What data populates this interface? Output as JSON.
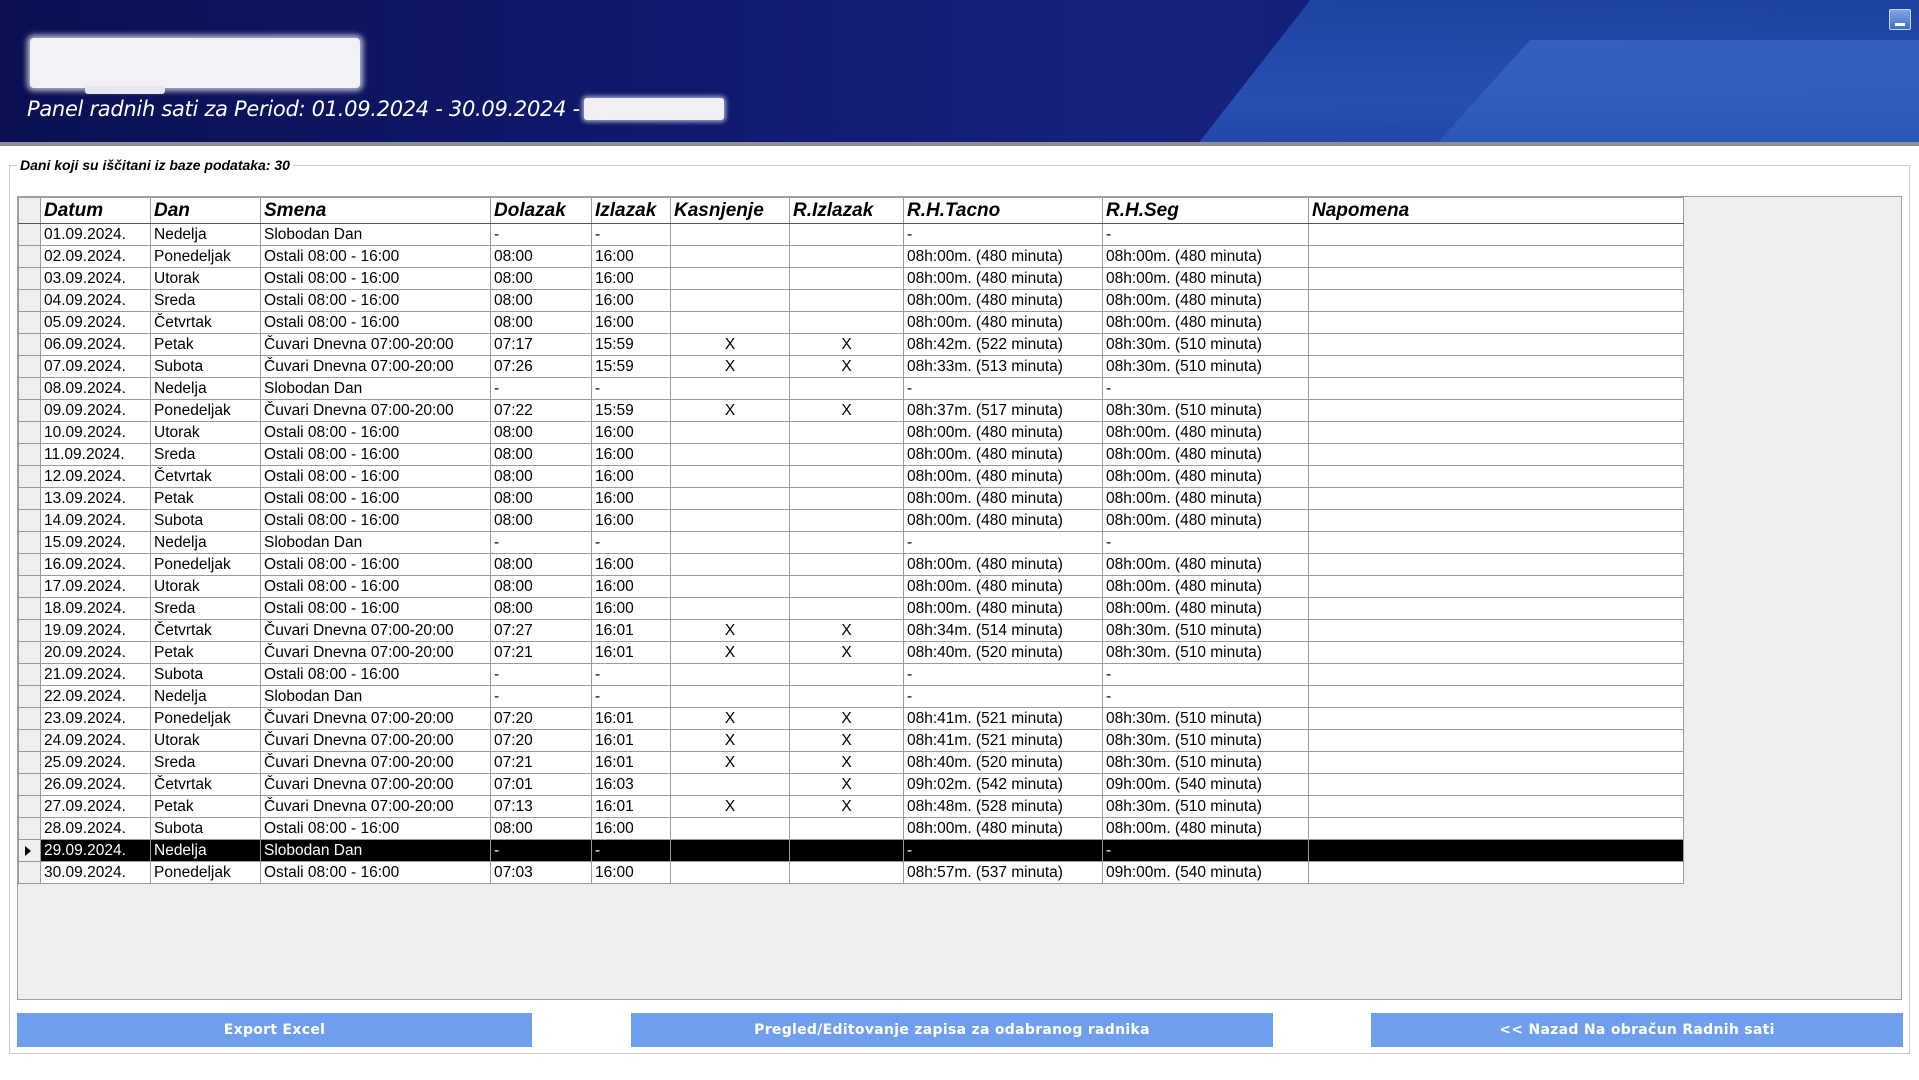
{
  "header": {
    "panel_title": "Panel radnih sati za Period: 01.09.2024 - 30.09.2024 -"
  },
  "groupbox": {
    "title": "Dani koji su iščitani iz baze podataka: 30"
  },
  "grid": {
    "columns": [
      "Datum",
      "Dan",
      "Smena",
      "Dolazak",
      "Izlazak",
      "Kasnjenje",
      "R.Izlazak",
      "R.H.Tacno",
      "R.H.Seg",
      "Napomena"
    ],
    "selected_row_index": 28,
    "rows": [
      [
        "01.09.2024.",
        "Nedelja",
        "Slobodan Dan",
        "-",
        "-",
        "",
        "",
        "-",
        "-",
        ""
      ],
      [
        "02.09.2024.",
        "Ponedeljak",
        "Ostali 08:00 - 16:00",
        "08:00",
        "16:00",
        "",
        "",
        "08h:00m. (480 minuta)",
        "08h:00m. (480 minuta)",
        ""
      ],
      [
        "03.09.2024.",
        "Utorak",
        "Ostali 08:00 - 16:00",
        "08:00",
        "16:00",
        "",
        "",
        "08h:00m. (480 minuta)",
        "08h:00m. (480 minuta)",
        ""
      ],
      [
        "04.09.2024.",
        "Sreda",
        "Ostali 08:00 - 16:00",
        "08:00",
        "16:00",
        "",
        "",
        "08h:00m. (480 minuta)",
        "08h:00m. (480 minuta)",
        ""
      ],
      [
        "05.09.2024.",
        "Četvrtak",
        "Ostali 08:00 - 16:00",
        "08:00",
        "16:00",
        "",
        "",
        "08h:00m. (480 minuta)",
        "08h:00m. (480 minuta)",
        ""
      ],
      [
        "06.09.2024.",
        "Petak",
        "Čuvari Dnevna 07:00-20:00",
        "07:17",
        "15:59",
        "X",
        "X",
        "08h:42m. (522 minuta)",
        "08h:30m. (510 minuta)",
        ""
      ],
      [
        "07.09.2024.",
        "Subota",
        "Čuvari Dnevna 07:00-20:00",
        "07:26",
        "15:59",
        "X",
        "X",
        "08h:33m. (513 minuta)",
        "08h:30m. (510 minuta)",
        ""
      ],
      [
        "08.09.2024.",
        "Nedelja",
        "Slobodan Dan",
        "-",
        "-",
        "",
        "",
        "-",
        "-",
        ""
      ],
      [
        "09.09.2024.",
        "Ponedeljak",
        "Čuvari Dnevna 07:00-20:00",
        "07:22",
        "15:59",
        "X",
        "X",
        "08h:37m. (517 minuta)",
        "08h:30m. (510 minuta)",
        ""
      ],
      [
        "10.09.2024.",
        "Utorak",
        "Ostali 08:00 - 16:00",
        "08:00",
        "16:00",
        "",
        "",
        "08h:00m. (480 minuta)",
        "08h:00m. (480 minuta)",
        ""
      ],
      [
        "11.09.2024.",
        "Sreda",
        "Ostali 08:00 - 16:00",
        "08:00",
        "16:00",
        "",
        "",
        "08h:00m. (480 minuta)",
        "08h:00m. (480 minuta)",
        ""
      ],
      [
        "12.09.2024.",
        "Četvrtak",
        "Ostali 08:00 - 16:00",
        "08:00",
        "16:00",
        "",
        "",
        "08h:00m. (480 minuta)",
        "08h:00m. (480 minuta)",
        ""
      ],
      [
        "13.09.2024.",
        "Petak",
        "Ostali 08:00 - 16:00",
        "08:00",
        "16:00",
        "",
        "",
        "08h:00m. (480 minuta)",
        "08h:00m. (480 minuta)",
        ""
      ],
      [
        "14.09.2024.",
        "Subota",
        "Ostali 08:00 - 16:00",
        "08:00",
        "16:00",
        "",
        "",
        "08h:00m. (480 minuta)",
        "08h:00m. (480 minuta)",
        ""
      ],
      [
        "15.09.2024.",
        "Nedelja",
        "Slobodan Dan",
        "-",
        "-",
        "",
        "",
        "-",
        "-",
        ""
      ],
      [
        "16.09.2024.",
        "Ponedeljak",
        "Ostali 08:00 - 16:00",
        "08:00",
        "16:00",
        "",
        "",
        "08h:00m. (480 minuta)",
        "08h:00m. (480 minuta)",
        ""
      ],
      [
        "17.09.2024.",
        "Utorak",
        "Ostali 08:00 - 16:00",
        "08:00",
        "16:00",
        "",
        "",
        "08h:00m. (480 minuta)",
        "08h:00m. (480 minuta)",
        ""
      ],
      [
        "18.09.2024.",
        "Sreda",
        "Ostali 08:00 - 16:00",
        "08:00",
        "16:00",
        "",
        "",
        "08h:00m. (480 minuta)",
        "08h:00m. (480 minuta)",
        ""
      ],
      [
        "19.09.2024.",
        "Četvrtak",
        "Čuvari Dnevna 07:00-20:00",
        "07:27",
        "16:01",
        "X",
        "X",
        "08h:34m. (514 minuta)",
        "08h:30m. (510 minuta)",
        ""
      ],
      [
        "20.09.2024.",
        "Petak",
        "Čuvari Dnevna 07:00-20:00",
        "07:21",
        "16:01",
        "X",
        "X",
        "08h:40m. (520 minuta)",
        "08h:30m. (510 minuta)",
        ""
      ],
      [
        "21.09.2024.",
        "Subota",
        "Ostali 08:00 - 16:00",
        "-",
        "-",
        "",
        "",
        "-",
        "-",
        ""
      ],
      [
        "22.09.2024.",
        "Nedelja",
        "Slobodan Dan",
        "-",
        "-",
        "",
        "",
        "-",
        "-",
        ""
      ],
      [
        "23.09.2024.",
        "Ponedeljak",
        "Čuvari Dnevna 07:00-20:00",
        "07:20",
        "16:01",
        "X",
        "X",
        "08h:41m. (521 minuta)",
        "08h:30m. (510 minuta)",
        ""
      ],
      [
        "24.09.2024.",
        "Utorak",
        "Čuvari Dnevna 07:00-20:00",
        "07:20",
        "16:01",
        "X",
        "X",
        "08h:41m. (521 minuta)",
        "08h:30m. (510 minuta)",
        ""
      ],
      [
        "25.09.2024.",
        "Sreda",
        "Čuvari Dnevna 07:00-20:00",
        "07:21",
        "16:01",
        "X",
        "X",
        "08h:40m. (520 minuta)",
        "08h:30m. (510 minuta)",
        ""
      ],
      [
        "26.09.2024.",
        "Četvrtak",
        "Čuvari Dnevna 07:00-20:00",
        "07:01",
        "16:03",
        "",
        "X",
        "09h:02m. (542 minuta)",
        "09h:00m. (540 minuta)",
        ""
      ],
      [
        "27.09.2024.",
        "Petak",
        "Čuvari Dnevna 07:00-20:00",
        "07:13",
        "16:01",
        "X",
        "X",
        "08h:48m. (528 minuta)",
        "08h:30m. (510 minuta)",
        ""
      ],
      [
        "28.09.2024.",
        "Subota",
        "Ostali 08:00 - 16:00",
        "08:00",
        "16:00",
        "",
        "",
        "08h:00m. (480 minuta)",
        "08h:00m. (480 minuta)",
        ""
      ],
      [
        "29.09.2024.",
        "Nedelja",
        "Slobodan Dan",
        "-",
        "-",
        "",
        "",
        "-",
        "-",
        ""
      ],
      [
        "30.09.2024.",
        "Ponedeljak",
        "Ostali 08:00 - 16:00",
        "07:03",
        "16:00",
        "",
        "",
        "08h:57m. (537 minuta)",
        "09h:00m. (540 minuta)",
        ""
      ]
    ]
  },
  "buttons": {
    "export": "Export Excel",
    "review": "Pregled/Editovanje zapisa za odabranog radnika",
    "back": "<< Nazad Na obračun Radnih sati"
  },
  "icons": {
    "window_control": "minimize-icon",
    "row_indicator": "triangle-right-icon"
  },
  "colors": {
    "header_bg": "#0f1a6e",
    "button_bg": "#6f9fec",
    "selected_row_bg": "#000000"
  }
}
